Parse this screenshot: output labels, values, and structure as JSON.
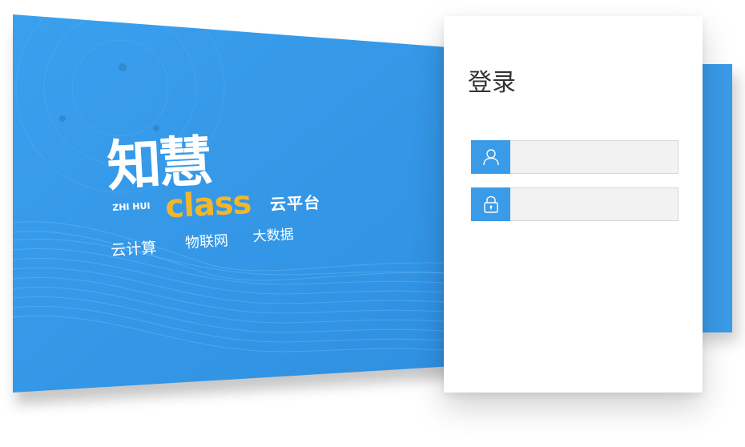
{
  "banner": {
    "logo_brand": "知慧",
    "logo_pinyin": "ZHI HUI",
    "logo_word": "class",
    "cloud_label": "云平台",
    "features": [
      "云计算",
      "物联网",
      "大数据"
    ]
  },
  "login": {
    "title": "登录",
    "username": {
      "value": "",
      "placeholder": ""
    },
    "password": {
      "value": "",
      "placeholder": ""
    }
  },
  "colors": {
    "brand_blue": "#3a9be8",
    "logo_yellow": "#f2b62b",
    "card_bg": "#ffffff",
    "input_bg": "#f2f2f2"
  },
  "icons": {
    "user": "user-icon",
    "lock": "lock-icon"
  }
}
